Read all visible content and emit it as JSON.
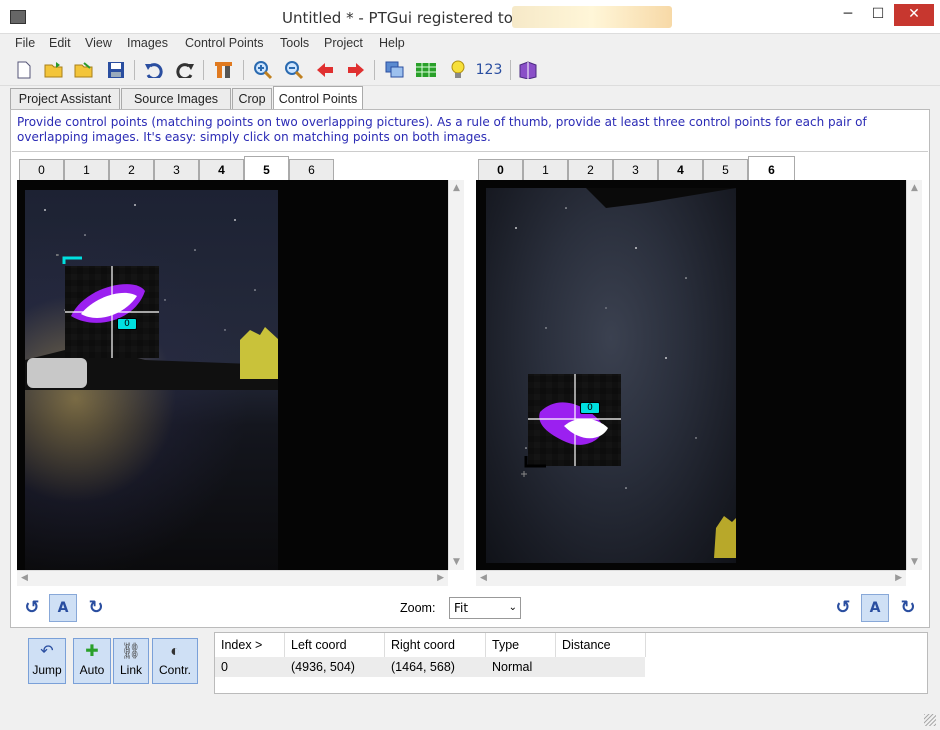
{
  "window": {
    "title": "Untitled * - PTGui registered to",
    "min": "─",
    "max": "☐",
    "close": "✕"
  },
  "menu": [
    "File",
    "Edit",
    "View",
    "Images",
    "Control Points",
    "Tools",
    "Project",
    "Help"
  ],
  "toolbar": {
    "numbering_label": "123"
  },
  "tabs": [
    "Project Assistant",
    "Source Images",
    "Crop",
    "Control Points"
  ],
  "active_tab": "Control Points",
  "instructions": "Provide control points (matching points on two overlapping pictures). As a rule of thumb, provide at least three control points for each pair of overlapping images. It's easy: simply click on matching points on both images.",
  "left_pane": {
    "image_tabs": [
      "0",
      "1",
      "2",
      "3",
      "4",
      "5",
      "6"
    ],
    "active": "5",
    "bold": [
      "4"
    ],
    "cp_label": "0"
  },
  "right_pane": {
    "image_tabs": [
      "0",
      "1",
      "2",
      "3",
      "4",
      "5",
      "6"
    ],
    "active": "6",
    "bold": [
      "0",
      "4"
    ],
    "cp_label": "0"
  },
  "zoom": {
    "label": "Zoom:",
    "value": "Fit"
  },
  "auto_button_label": "A",
  "actions": [
    {
      "label": "Jump",
      "icon": "jump-icon"
    },
    {
      "label": "Auto",
      "icon": "auto-icon"
    },
    {
      "label": "Link",
      "icon": "link-icon"
    },
    {
      "label": "Contr.",
      "icon": "contrast-icon"
    }
  ],
  "cp_table": {
    "headers": [
      "Index >",
      "Left coord",
      "Right coord",
      "Type",
      "Distance"
    ],
    "rows": [
      [
        "0",
        "(4936, 504)",
        "(1464, 568)",
        "Normal",
        ""
      ]
    ]
  }
}
